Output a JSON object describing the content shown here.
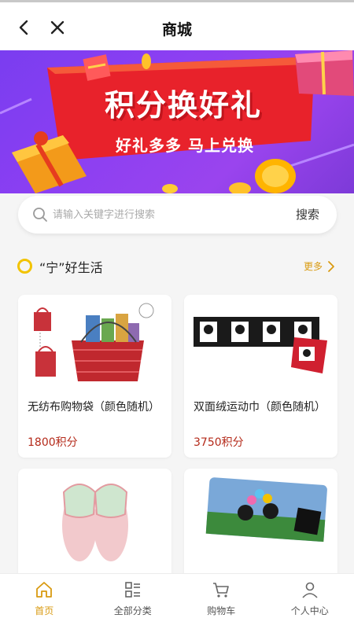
{
  "header": {
    "title": "商城"
  },
  "banner": {
    "headline": "积分换好礼",
    "sub": "好礼多多  马上兑换"
  },
  "search": {
    "placeholder": "请输入关键字进行搜索",
    "button": "搜索"
  },
  "section": {
    "title": "“宁”好生活",
    "more": "更多"
  },
  "products": [
    {
      "name": "无纺布购物袋（颜色随机）",
      "price": "1800积分"
    },
    {
      "name": "双面绒运动巾（颜色随机）",
      "price": "3750积分"
    },
    {
      "name": "",
      "price": ""
    },
    {
      "name": "",
      "price": ""
    }
  ],
  "tabs": [
    {
      "label": "首页",
      "icon": "home-icon",
      "active": true
    },
    {
      "label": "全部分类",
      "icon": "category-icon",
      "active": false
    },
    {
      "label": "购物车",
      "icon": "cart-icon",
      "active": false
    },
    {
      "label": "个人中心",
      "icon": "user-icon",
      "active": false
    }
  ],
  "colors": {
    "accent": "#d99a10",
    "price": "#b42a1a",
    "banner": "#8b3ff2"
  }
}
